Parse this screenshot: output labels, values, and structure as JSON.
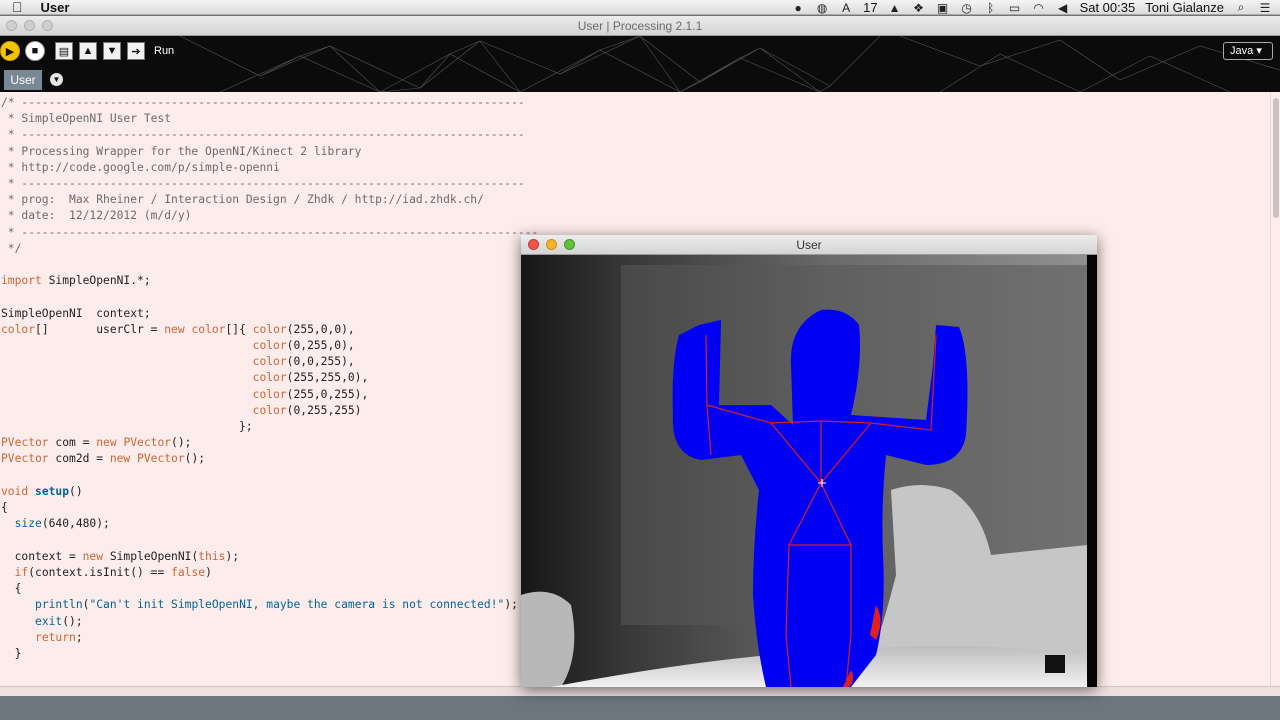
{
  "menubar": {
    "app_name": "User",
    "battery": "17",
    "clock": "Sat 00:35",
    "user": "Toni Gialanze"
  },
  "window": {
    "title": "User | Processing 2.1.1"
  },
  "toolbar": {
    "run_label": "Run",
    "mode": "Java"
  },
  "tabs": [
    {
      "label": "User"
    }
  ],
  "editor": {
    "lines": [
      "/* --------------------------------------------------------------------------",
      " * SimpleOpenNI User Test",
      " * --------------------------------------------------------------------------",
      " * Processing Wrapper for the OpenNI/Kinect 2 library",
      " * http://code.google.com/p/simple-openni",
      " * --------------------------------------------------------------------------",
      " * prog:  Max Rheiner / Interaction Design / Zhdk / http://iad.zhdk.ch/",
      " * date:  12/12/2012 (m/d/y)",
      " * ----------------------------------------------------------------------------",
      " */",
      "",
      "import SimpleOpenNI.*;",
      "",
      "SimpleOpenNI  context;",
      "color[]       userClr = new color[]{ color(255,0,0),",
      "                                     color(0,255,0),",
      "                                     color(0,0,255),",
      "                                     color(255,255,0),",
      "                                     color(255,0,255),",
      "                                     color(0,255,255)",
      "                                   };",
      "PVector com = new PVector();",
      "PVector com2d = new PVector();",
      "",
      "void setup()",
      "{",
      "  size(640,480);",
      "",
      "  context = new SimpleOpenNI(this);",
      "  if(context.isInit() == false)",
      "  {",
      "     println(\"Can't init SimpleOpenNI, maybe the camera is not connected!\");",
      "     exit();",
      "     return;",
      "  }"
    ]
  },
  "sketch": {
    "title": "User"
  }
}
